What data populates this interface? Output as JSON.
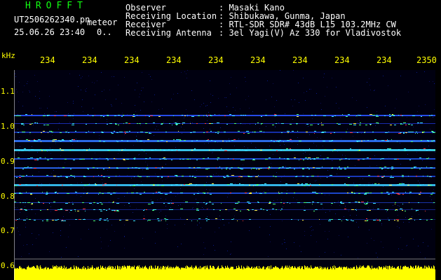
{
  "header": {
    "logo": "HROFFT",
    "filename": "UT2506262340.pn",
    "mode": "meteor",
    "datetime": "25.06.26 23:40",
    "count": "0.."
  },
  "info": [
    {
      "label": "Observer",
      "value": ": Masaki Kano"
    },
    {
      "label": "Receiving Location",
      "value": ": Shibukawa, Gunma, Japan"
    },
    {
      "label": "Receiver",
      "value": ": RTL-SDR SDR# 43dB L15 103.2MHz CW"
    },
    {
      "label": "Receiving Antenna",
      "value": ": 3el Yagi(V) Az 330 for Vladivostok"
    }
  ],
  "axis": {
    "unit": "kHz",
    "time_labels": [
      "234",
      "234",
      "234",
      "234",
      "234",
      "234",
      "234",
      "234",
      "234",
      "2350"
    ],
    "freq_labels": [
      "1.1",
      "1.0",
      "0.9",
      "0.8",
      "0.7",
      "0.6"
    ]
  },
  "colors": {
    "text": "#ffffff",
    "logo": "#12ff12",
    "axis": "#ffff00",
    "background": "#000000",
    "noise_bar": "#ffff00"
  }
}
